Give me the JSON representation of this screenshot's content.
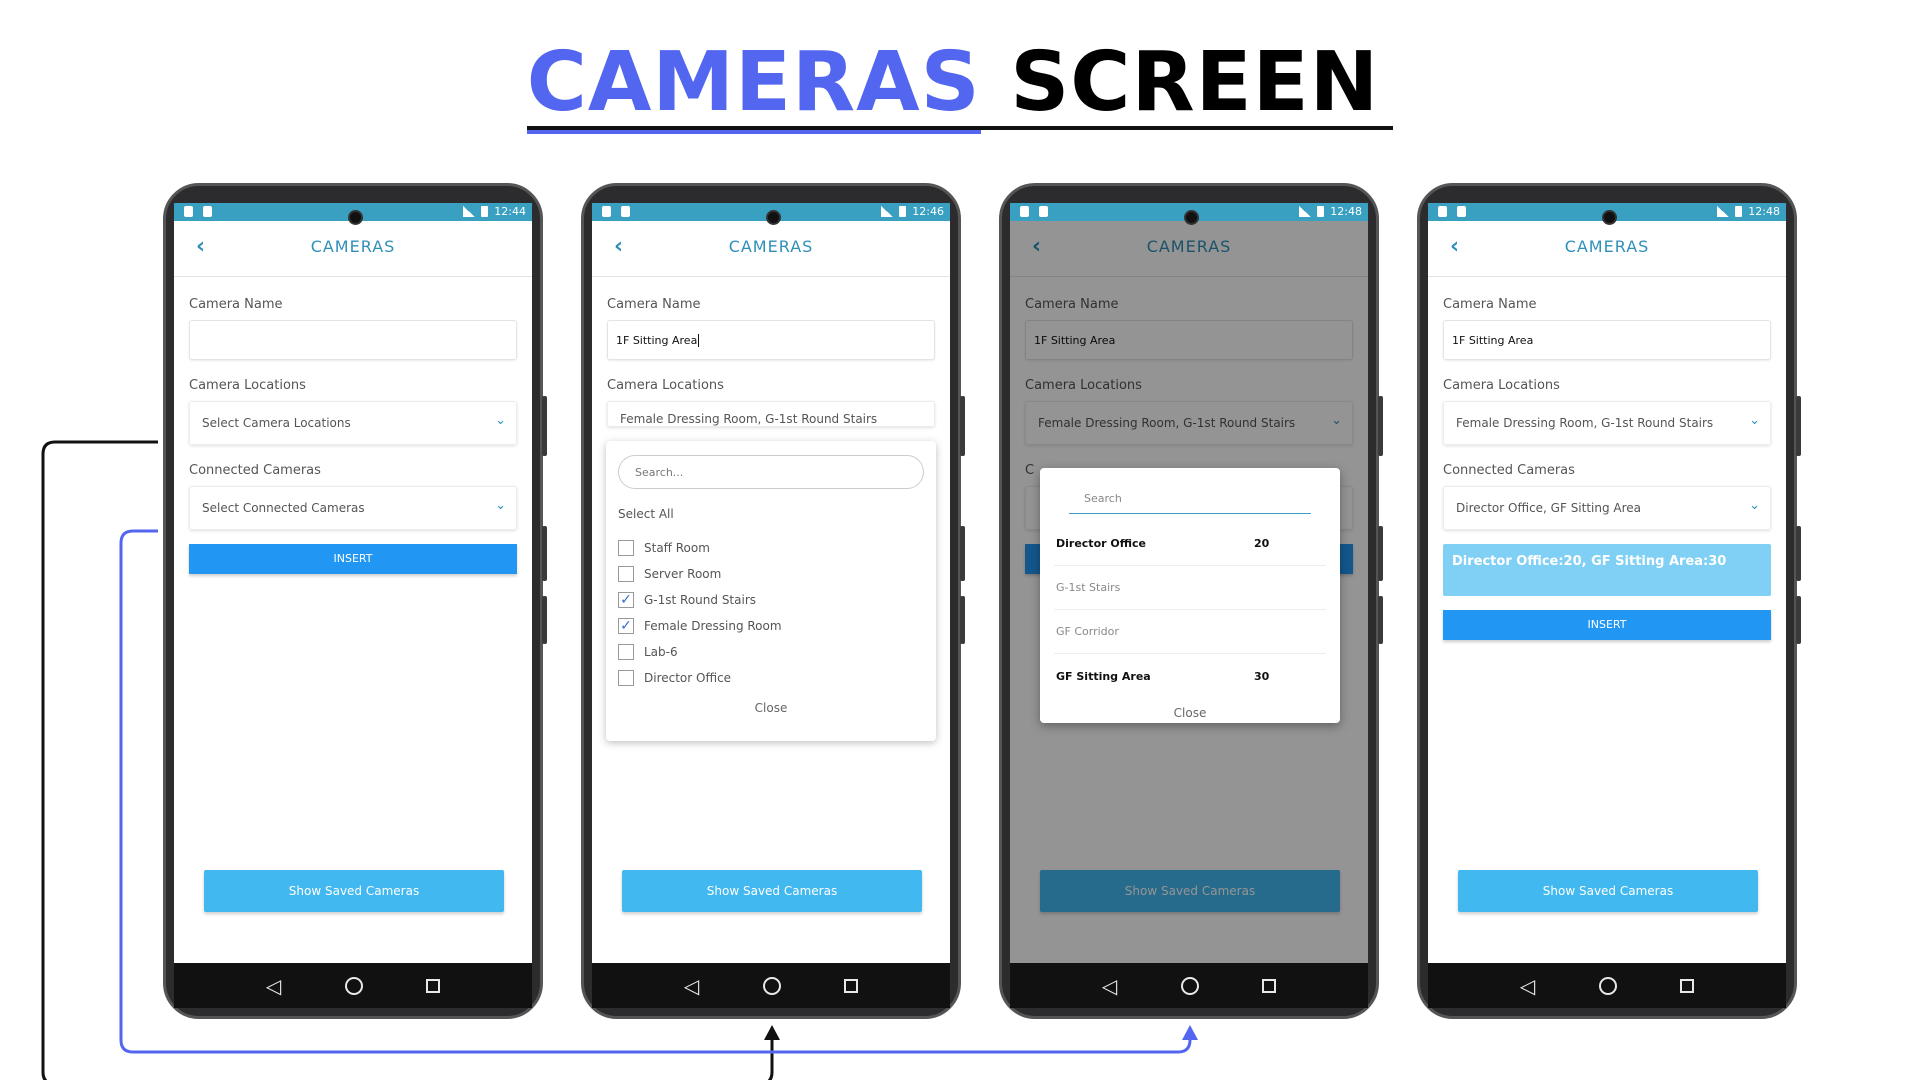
{
  "header": {
    "title_part1": "CAMERAS",
    "title_part2": "SCREEN"
  },
  "colors": {
    "accent": "#5366f0",
    "teal": "#3aa0c2",
    "insert": "#2196f3",
    "show_button": "#42b8f0",
    "result_box": "#80d0f5"
  },
  "common": {
    "app_title": "CAMERAS",
    "back_icon": "chevron-left-icon",
    "label_camera_name": "Camera Name",
    "label_camera_locations": "Camera Locations",
    "label_connected_cameras": "Connected Cameras",
    "insert_label": "INSERT",
    "show_saved_label": "Show Saved Cameras"
  },
  "phones": [
    {
      "time": "12:44",
      "camera_name_value": "",
      "locations_value": "Select Camera Locations",
      "connected_value": "Select Connected Cameras"
    },
    {
      "time": "12:46",
      "camera_name_value": "1F Sitting Area",
      "locations_value": "Female Dressing Room, G-1st Round Stairs",
      "dropdown": {
        "search_placeholder": "Search...",
        "select_all": "Select All",
        "options": [
          {
            "label": "Staff Room",
            "checked": false
          },
          {
            "label": "Server Room",
            "checked": false
          },
          {
            "label": "G-1st Round Stairs",
            "checked": true
          },
          {
            "label": "Female Dressing Room",
            "checked": true
          },
          {
            "label": "Lab-6",
            "checked": false
          },
          {
            "label": "Director Office",
            "checked": false
          }
        ],
        "close": "Close"
      }
    },
    {
      "time": "12:48",
      "camera_name_value": "1F Sitting Area",
      "locations_value": "Female Dressing Room, G-1st Round Stairs",
      "modal": {
        "search_placeholder": "Search",
        "rows": [
          {
            "name": "Director Office",
            "value": "20"
          },
          {
            "name": "G-1st Stairs",
            "value": ""
          },
          {
            "name": "GF Corridor",
            "value": ""
          },
          {
            "name": "GF Sitting Area",
            "value": "30"
          }
        ],
        "close": "Close"
      }
    },
    {
      "time": "12:48",
      "camera_name_value": "1F Sitting Area",
      "locations_value": "Female Dressing Room, G-1st Round Stairs",
      "connected_value": "Director Office, GF Sitting Area",
      "result_text": "Director Office:20, GF Sitting Area:30"
    }
  ]
}
